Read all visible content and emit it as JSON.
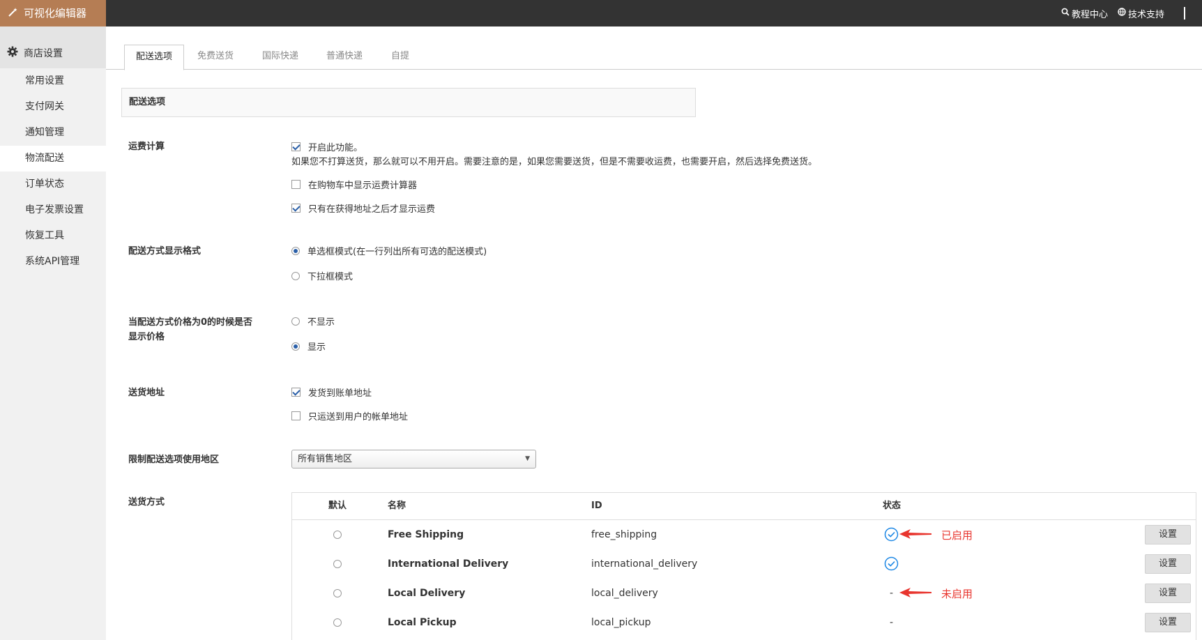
{
  "topbar": {
    "brand": "可视化编辑器",
    "links": [
      {
        "label": "教程中心",
        "icon": "search-icon"
      },
      {
        "label": "技术支持",
        "icon": "globe-icon"
      }
    ],
    "accent": "#b57d54",
    "background": "#333333"
  },
  "sidebar": {
    "section": "商店设置",
    "items": [
      {
        "label": "常用设置",
        "active": false
      },
      {
        "label": "支付网关",
        "active": false
      },
      {
        "label": "通知管理",
        "active": false
      },
      {
        "label": "物流配送",
        "active": true
      },
      {
        "label": "订单状态",
        "active": false
      },
      {
        "label": "电子发票设置",
        "active": false
      },
      {
        "label": "恢复工具",
        "active": false
      },
      {
        "label": "系统API管理",
        "active": false
      }
    ]
  },
  "tabs": [
    {
      "label": "配送选项",
      "active": true
    },
    {
      "label": "免费送货",
      "active": false
    },
    {
      "label": "国际快递",
      "active": false
    },
    {
      "label": "普通快递",
      "active": false
    },
    {
      "label": "自提",
      "active": false
    }
  ],
  "section_title": "配送选项",
  "freight": {
    "label": "运费计算",
    "enable": {
      "label": "开启此功能。",
      "checked": true
    },
    "description": "如果您不打算送货，那么就可以不用开启。需要注意的是，如果您需要送货，但是不需要收运费，也需要开启，然后选择免费送货。",
    "cart_calc": {
      "label": "在购物车中显示运费计算器",
      "checked": false
    },
    "after_address": {
      "label": "只有在获得地址之后才显示运费",
      "checked": true
    }
  },
  "display_format": {
    "label": "配送方式显示格式",
    "options": [
      {
        "label": "单选框模式(在一行列出所有可选的配送模式)",
        "selected": true
      },
      {
        "label": "下拉框模式",
        "selected": false
      }
    ]
  },
  "zero_price": {
    "label_line1": "当配送方式价格为0的时候是否",
    "label_line2": "显示价格",
    "options": [
      {
        "label": "不显示",
        "selected": false
      },
      {
        "label": "显示",
        "selected": true
      }
    ]
  },
  "ship_address": {
    "label": "送货地址",
    "options": [
      {
        "label": "发货到账单地址",
        "checked": true
      },
      {
        "label": "只运送到用户的帐单地址",
        "checked": false
      }
    ]
  },
  "region": {
    "label": "限制配送选项使用地区",
    "selected": "所有销售地区"
  },
  "methods": {
    "label": "送货方式",
    "columns": [
      "默认",
      "名称",
      "ID",
      "状态"
    ],
    "rows": [
      {
        "name": "Free Shipping",
        "id": "free_shipping",
        "enabled": true,
        "status_text": "",
        "annotation": "已启用",
        "button": "设置"
      },
      {
        "name": "International Delivery",
        "id": "international_delivery",
        "enabled": true,
        "status_text": "",
        "annotation": "",
        "button": "设置"
      },
      {
        "name": "Local Delivery",
        "id": "local_delivery",
        "enabled": false,
        "status_text": "-",
        "annotation": "未启用",
        "button": "设置"
      },
      {
        "name": "Local Pickup",
        "id": "local_pickup",
        "enabled": false,
        "status_text": "-",
        "annotation": "",
        "button": "设置"
      }
    ],
    "enabled_color": "#1e88e5",
    "annotation_color": "#e8352e"
  }
}
